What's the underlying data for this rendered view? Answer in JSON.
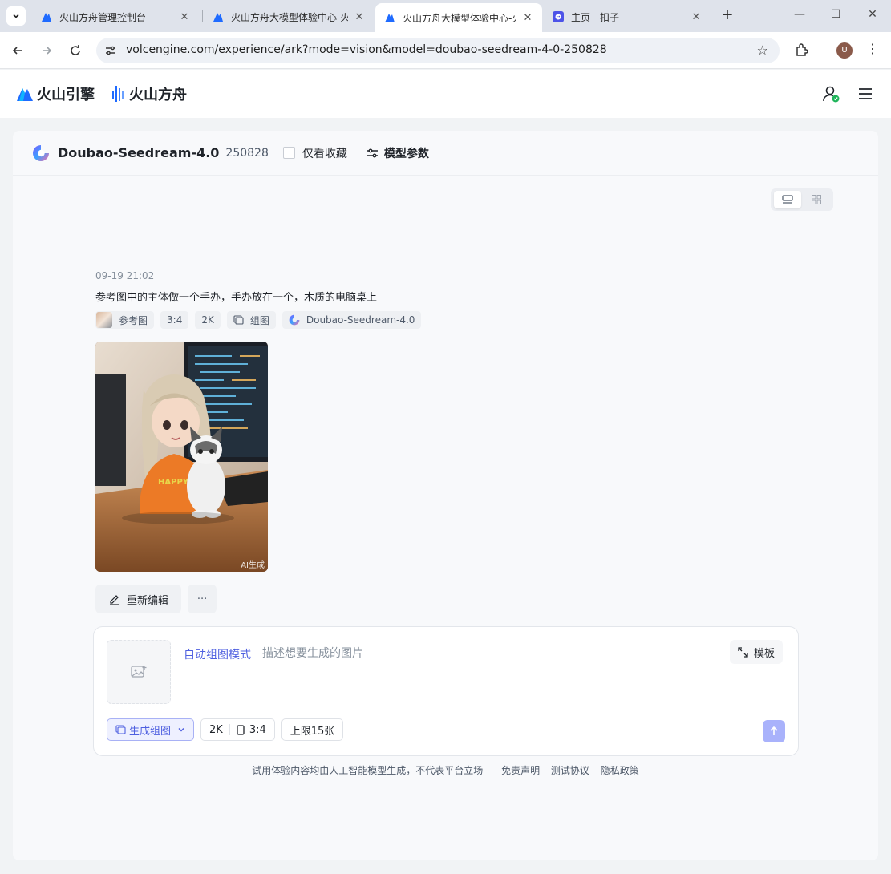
{
  "browser": {
    "tabs": [
      {
        "title": "火山方舟管理控制台",
        "active": false
      },
      {
        "title": "火山方舟大模型体验中心-火山引擎",
        "active": false
      },
      {
        "title": "火山方舟大模型体验中心-火山引擎",
        "active": true
      },
      {
        "title": "主页 - 扣子",
        "active": false
      }
    ],
    "url": "volcengine.com/experience/ark?mode=vision&model=doubao-seedream-4-0-250828",
    "profile_initial": "U"
  },
  "header": {
    "brand_primary": "火山引擎",
    "brand_secondary": "火山方舟"
  },
  "model_bar": {
    "model_name": "Doubao-Seedream-4.0",
    "model_version": "250828",
    "favorites_only_label": "仅看收藏",
    "params_label": "模型参数"
  },
  "message": {
    "time": "09-19 21:02",
    "prompt": "参考图中的主体做一个手办，手办放在一个，木质的电脑桌上",
    "chips": {
      "reference": "参考图",
      "ratio": "3:4",
      "resolution": "2K",
      "group": "组图",
      "model": "Doubao-Seedream-4.0"
    },
    "image_watermark": "AI生成",
    "image_shirt_text": "HAPPY",
    "reedit_label": "重新编辑",
    "more_label": "···"
  },
  "composer": {
    "mode_label": "自动组图模式",
    "placeholder": "描述想要生成的图片",
    "template_label": "模板",
    "generate_group_label": "生成组图",
    "resolution": "2K",
    "ratio": "3:4",
    "limit_label": "上限15张"
  },
  "footer": {
    "disclaimer": "试用体验内容均由人工智能模型生成，不代表平台立场",
    "links": [
      "免责声明",
      "测试协议",
      "隐私政策"
    ]
  },
  "colors": {
    "accent": "#4e5fe0",
    "send_button": "#a9b2fb",
    "status_green": "#1fb45a"
  }
}
